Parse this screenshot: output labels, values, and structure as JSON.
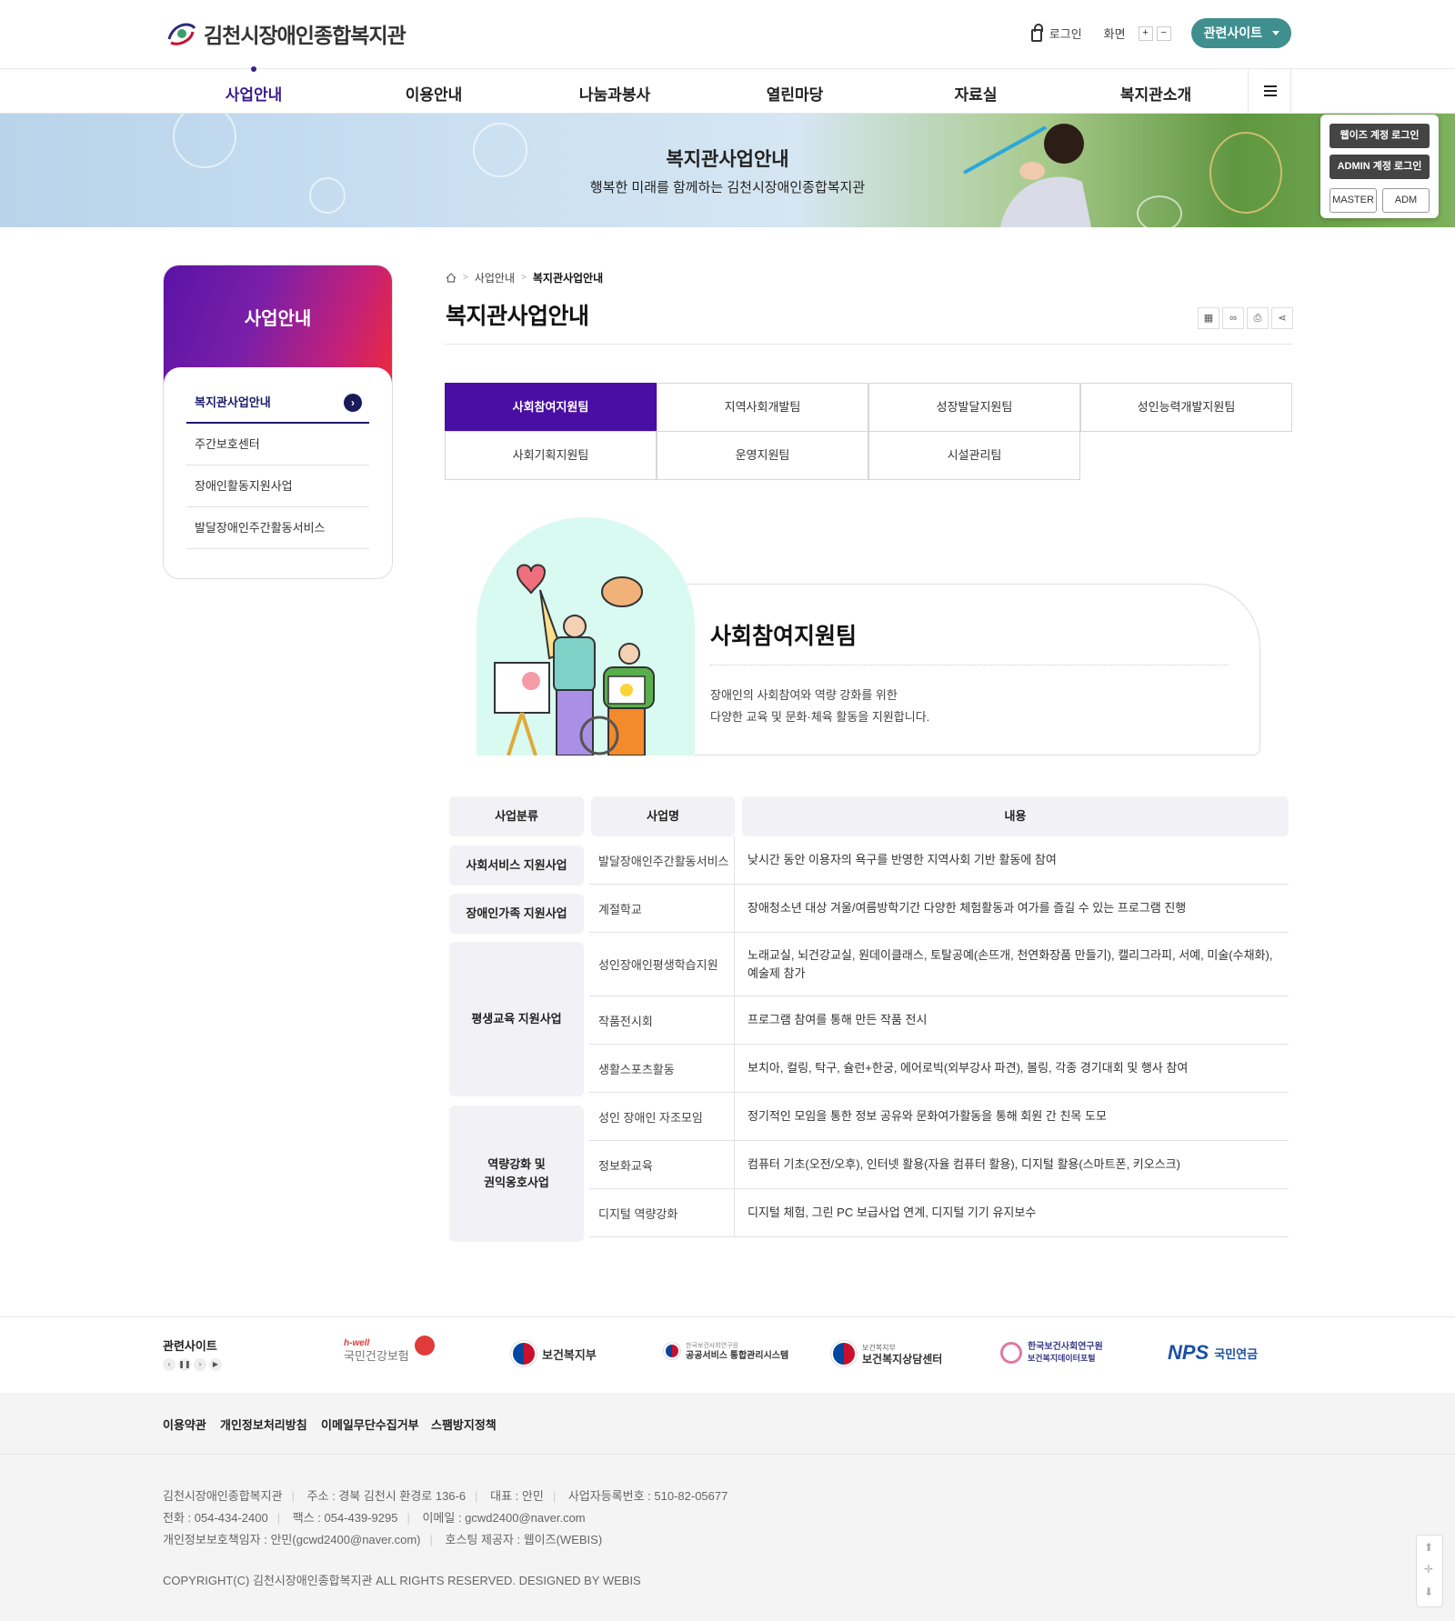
{
  "header": {
    "logo_text": "김천시장애인종합복지관",
    "login": "로그인",
    "screen": "화면",
    "zoom_in": "+",
    "zoom_out": "−",
    "related_site": "관련사이트"
  },
  "gnb": [
    "사업안내",
    "이용안내",
    "나눔과봉사",
    "열린마당",
    "자료실",
    "복지관소개"
  ],
  "visual": {
    "title": "복지관사업안내",
    "subtitle": "행복한 미래를 함께하는 김천시장애인종합복지관"
  },
  "admin": {
    "webis_login": "웹이즈 계정 로그인",
    "admin_login": "ADMIN 계정 로그인",
    "master": "MASTER",
    "adm": "ADM"
  },
  "lnb": {
    "title": "사업안내",
    "items": [
      "복지관사업안내",
      "주간보호센터",
      "장애인활동지원사업",
      "발달장애인주간활동서비스"
    ]
  },
  "breadcrumb": [
    "사업안내",
    "복지관사업안내"
  ],
  "page_title": "복지관사업안내",
  "tabs": [
    "사회참여지원팀",
    "지역사회개발팀",
    "성장발달지원팀",
    "성인능력개발지원팀",
    "사회기획지원팀",
    "운영지원팀",
    "시설관리팀"
  ],
  "intro": {
    "title": "사회참여지원팀",
    "desc_line1": "장애인의 사회참여와 역량 강화를 위한",
    "desc_line2": "다양한 교육 및 문화·체육 활동을 지원합니다."
  },
  "table": {
    "headers": [
      "사업분류",
      "사업명",
      "내용"
    ],
    "categories": [
      {
        "name": "사회서비스 지원사업"
      },
      {
        "name": "장애인가족 지원사업"
      },
      {
        "name": "평생교육 지원사업"
      },
      {
        "name_line1": "역량강화 및",
        "name_line2": "권익옹호사업"
      }
    ],
    "rows": [
      {
        "name": "발달장애인주간활동서비스",
        "content": "낮시간 동안 이용자의 욕구를 반영한 지역사회 기반 활동에 참여"
      },
      {
        "name": "계절학교",
        "content": "장애청소년 대상 겨울/여름방학기간 다양한 체험활동과 여가를 즐길 수 있는 프로그램 진행"
      },
      {
        "name": "성인장애인평생학습지원",
        "content": "노래교실, 뇌건강교실, 원데이클래스, 토탈공예(손뜨개, 천연화장품 만들기), 캘리그라피, 서예, 미술(수채화), 예술제 참가"
      },
      {
        "name": "작품전시회",
        "content": "프로그램 참여를 통해 만든 작품 전시"
      },
      {
        "name": "생활스포츠활동",
        "content": "보치아, 컬링, 탁구, 슐런+한궁, 에어로빅(외부강사 파견), 볼링, 각종 경기대회 및 행사 참여"
      },
      {
        "name": "성인 장애인 자조모임",
        "content": "정기적인 모임을 통한 정보 공유와 문화여가활동을 통해 회원 간 친목 도모"
      },
      {
        "name": "정보화교육",
        "content": "컴퓨터 기초(오전/오후), 인터넷 활용(자율 컴퓨터 활용), 디지털 활용(스마트폰, 키오스크)"
      },
      {
        "name": "디지털 역량강화",
        "content": "디지털 체험, 그린 PC 보급사업 연계, 디지털 기기 유지보수"
      }
    ]
  },
  "family_sites": {
    "title": "관련사이트",
    "logos": [
      {
        "small": "h-well",
        "name": "국민건강보험"
      },
      {
        "name": "보건복지부"
      },
      {
        "small": "한국보건사회연구원",
        "name": "공공서비스 통합관리시스템"
      },
      {
        "small": "보건복지부",
        "name": "보건복지상담센터"
      },
      {
        "name_line1": "한국보건사회연구원",
        "name_line2": "보건복지데이터포털"
      },
      {
        "brand": "NPS",
        "name": "국민연금"
      }
    ]
  },
  "footer": {
    "links": [
      "이용약관",
      "개인정보처리방침",
      "이메일무단수집거부",
      "스팸방지정책"
    ],
    "org": "김천시장애인종합복지관",
    "address": "주소 : 경북 김천시 환경로 136-6",
    "ceo": "대표 : 안민",
    "biz_no": "사업자등록번호 : 510-82-05677",
    "tel": "전화 : 054-434-2400",
    "fax": "팩스 : 054-439-9295",
    "email": "이메일 : gcwd2400@naver.com",
    "privacy": "개인정보보호책임자 : 안민(gcwd2400@naver.com)",
    "hosting": "호스팅 제공자 : 웹이즈(WEBIS)",
    "copyright": "COPYRIGHT(C) 김천시장애인종합복지관 ALL RIGHTS RESERVED. DESIGNED BY WEBIS"
  },
  "colors": {
    "primary_purple": "#4a0ea5",
    "teal": "#3f8f8f",
    "navy": "#1a1a6a"
  }
}
